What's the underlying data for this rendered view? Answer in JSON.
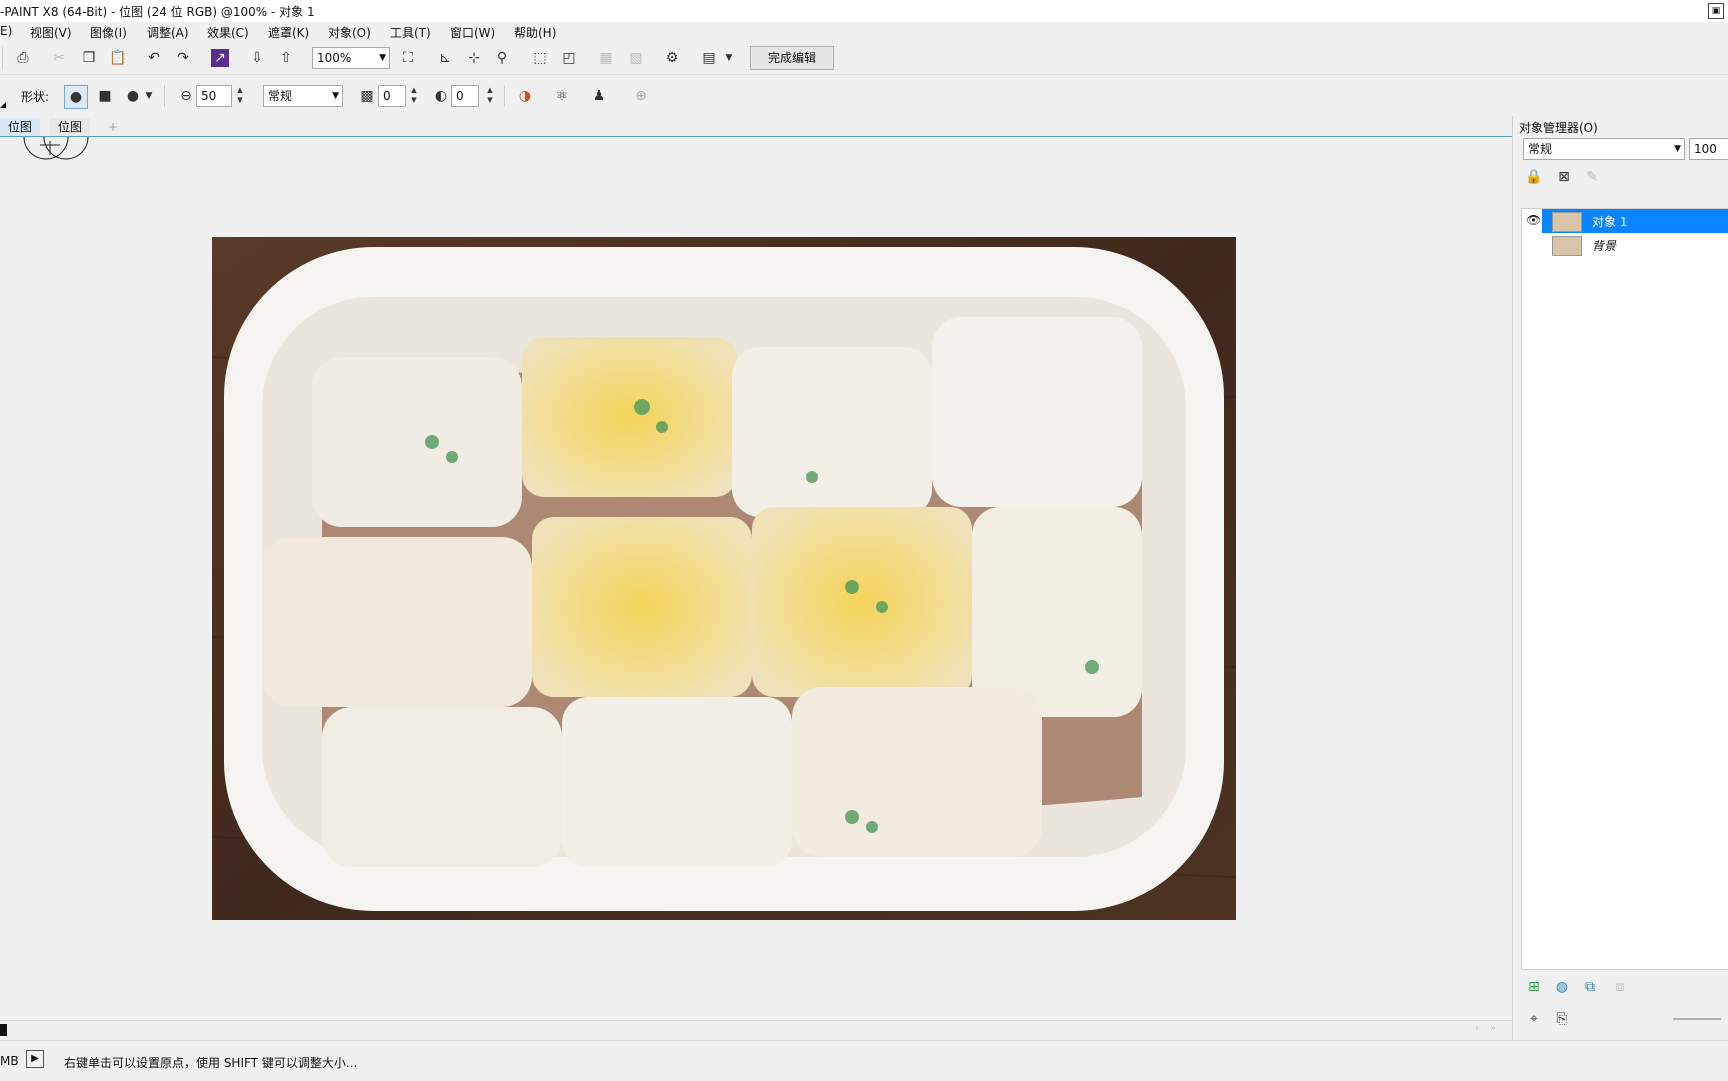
{
  "window": {
    "title": "-PAINT X8 (64-Bit) - 位图 (24 位 RGB) @100% - 对象 1"
  },
  "menu": [
    "E)",
    "视图(V)",
    "图像(I)",
    "调整(A)",
    "效果(C)",
    "遮罩(K)",
    "对象(O)",
    "工具(T)",
    "窗口(W)",
    "帮助(H)"
  ],
  "toolbar": {
    "zoom": "100%",
    "finish_label": "完成编辑"
  },
  "property_bar": {
    "shape_label": "形状:",
    "size_value": "50",
    "mode_value": "常规",
    "transparency_value": "0",
    "feather_value": "0"
  },
  "doc_tabs": [
    "位图",
    "位图",
    "+"
  ],
  "object_manager": {
    "title": "对象管理器(O)",
    "merge_mode": "常规",
    "opacity": "100",
    "layers": [
      {
        "name": "对象 1",
        "selected": true,
        "visible": true
      },
      {
        "name": "背景",
        "selected": false,
        "visible": false
      }
    ]
  },
  "status": {
    "left_text": "MB",
    "hint": "右键单击可以设置原点，使用 SHIFT 键可以调整大小..."
  },
  "colors": {
    "selection": "#0a84ff",
    "tab_underline": "#5b9bd5",
    "plate": "#f4f2ee",
    "table_wood": "#4b2f22"
  }
}
